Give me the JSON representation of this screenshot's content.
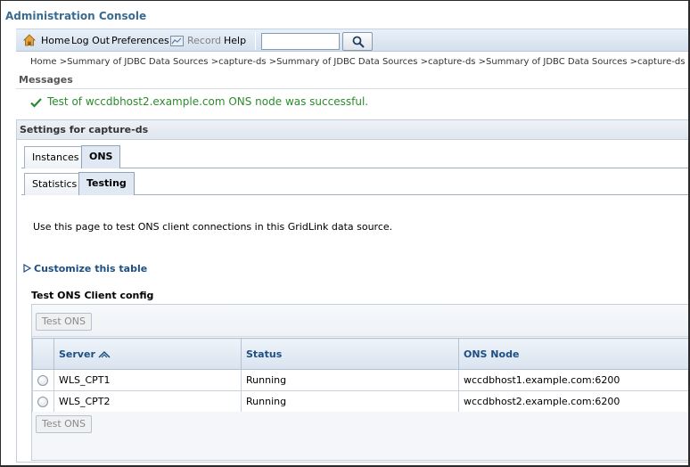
{
  "app": {
    "title": "Administration Console"
  },
  "toolbar": {
    "home_label": "Home",
    "logout_label": "Log Out",
    "preferences_label": "Preferences",
    "record_label": "Record",
    "help_label": "Help",
    "search_value": "",
    "search_placeholder": "",
    "icons": {
      "home": "home-icon",
      "record": "record-icon",
      "search": "search-icon"
    }
  },
  "breadcrumb": {
    "text": "Home >Summary of JDBC Data Sources >capture-ds >Summary of JDBC Data Sources >capture-ds >Summary of JDBC Data Sources >capture-ds >Summary of JDBC"
  },
  "messages": {
    "heading": "Messages",
    "success_text": "Test of wccdbhost2.example.com ONS node was successful.",
    "success_color": "#2d8a2d"
  },
  "settings": {
    "title": "Settings for capture-ds",
    "tabs_row1": [
      {
        "label": "Instances",
        "active": false
      },
      {
        "label": "ONS",
        "active": true
      }
    ],
    "tabs_row2": [
      {
        "label": "Statistics",
        "active": false
      },
      {
        "label": "Testing",
        "active": true
      }
    ],
    "intro": "Use this page to test ONS client connections in this GridLink data source.",
    "customize_label": "Customize this table",
    "section_title": "Test ONS Client config",
    "test_button_label": "Test ONS",
    "table": {
      "columns": [
        "Server",
        "Status",
        "ONS Node"
      ],
      "sorted_column": "Server",
      "rows": [
        {
          "server": "WLS_CPT1",
          "status": "Running",
          "ons_node": "wccdbhost1.example.com:6200"
        },
        {
          "server": "WLS_CPT2",
          "status": "Running",
          "ons_node": "wccdbhost2.example.com:6200"
        }
      ]
    }
  },
  "colors": {
    "title": "#3a6b91",
    "link": "#1d4f83",
    "toolbar": "#d4e0ee"
  }
}
